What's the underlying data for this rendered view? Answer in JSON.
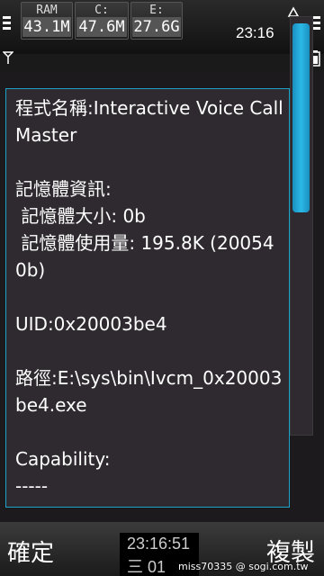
{
  "status_bar": {
    "widgets": [
      {
        "label": "RAM",
        "value": "43.1M"
      },
      {
        "label": "C:",
        "value": "47.6M"
      },
      {
        "label": "E:",
        "value": "27.6G"
      }
    ],
    "clock": "23:16",
    "icons": [
      "signal-bars-icon",
      "battery-bars-icon",
      "alarm-icon",
      "antenna-icon",
      "battery-icon"
    ]
  },
  "content": {
    "app_name_label": "程式名稱:Interactive Voice Call Master",
    "memory_heading": "記憶體資訊:",
    "memory_size": " 記憶體大小: 0b",
    "memory_usage": " 記憶體使用量: 195.8K (200540b)",
    "uid": "UID:0x20003be4",
    "path": "路徑:E:\\sys\\bin\\Ivcm_0x20003be4.exe",
    "capability_heading": "Capability:",
    "capability_divider": "-----"
  },
  "scrollbar": {
    "position_fraction": 0.0
  },
  "softkeys": {
    "left_label": "確定",
    "right_label": "複製"
  },
  "center_clock": {
    "time": "23:16:51",
    "date": "三 01"
  },
  "watermark": "miss70335 @ sogi.com.tw",
  "colors": {
    "accent": "#1aa3c8",
    "panel_bg": "#2f2a30",
    "text": "#ffffff"
  }
}
